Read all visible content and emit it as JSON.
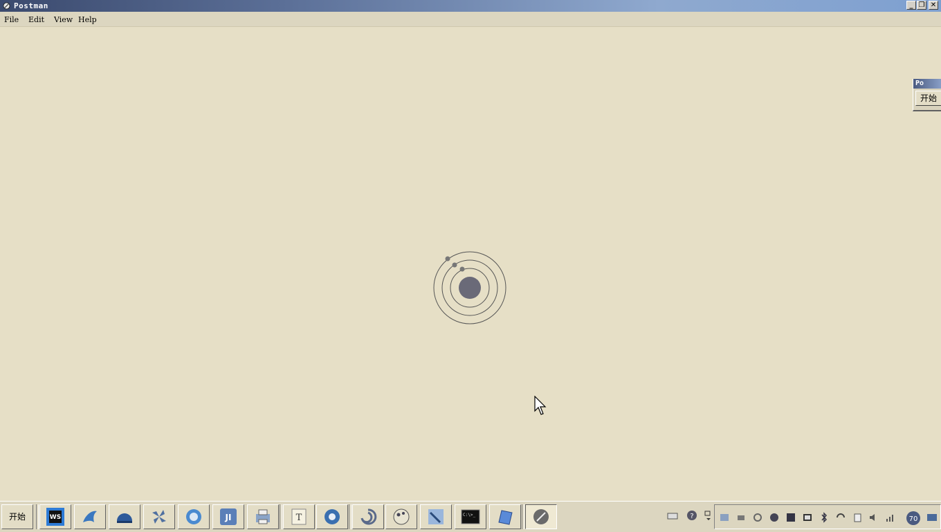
{
  "window": {
    "title": "Postman",
    "controls": [
      "minimize",
      "restore",
      "close"
    ]
  },
  "menubar": {
    "items": [
      "File",
      "Edit",
      "View",
      "Help"
    ]
  },
  "mini_window": {
    "title": "Po",
    "button_label": "开始"
  },
  "taskbar": {
    "start_label": "开始",
    "apps": [
      {
        "name": "webstorm-icon",
        "badge": "WS"
      },
      {
        "name": "dolphin-icon"
      },
      {
        "name": "dome-icon"
      },
      {
        "name": "pinwheel-icon"
      },
      {
        "name": "browser-icon"
      },
      {
        "name": "intellij-icon",
        "badge": "JI"
      },
      {
        "name": "printer-icon"
      },
      {
        "name": "text-editor-icon",
        "badge": "T"
      },
      {
        "name": "chrome-icon"
      },
      {
        "name": "swirl-icon"
      },
      {
        "name": "globe-icon"
      },
      {
        "name": "satellite-icon"
      },
      {
        "name": "terminal-icon",
        "badge": "C:\\>_"
      },
      {
        "name": "notepad-icon"
      },
      {
        "name": "postman-icon"
      }
    ],
    "tray": {
      "clock_badge": "70"
    }
  }
}
